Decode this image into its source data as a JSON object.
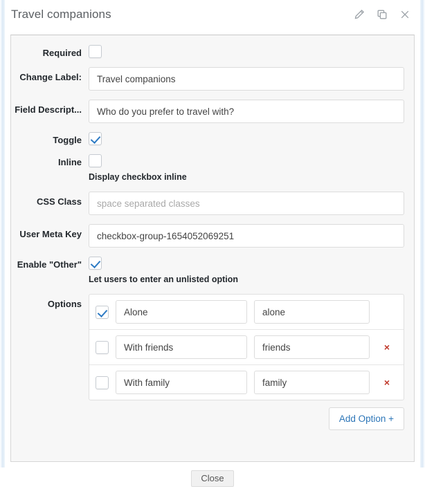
{
  "header": {
    "title": "Travel companions",
    "icons": [
      {
        "name": "edit-pencil-icon",
        "label": "Edit"
      },
      {
        "name": "duplicate-icon",
        "label": "Duplicate"
      },
      {
        "name": "close-icon",
        "label": "Close"
      }
    ]
  },
  "form": {
    "required": {
      "label": "Required",
      "checked": false
    },
    "change_label": {
      "label": "Change Label:",
      "value": "Travel companions",
      "placeholder": ""
    },
    "field_description": {
      "label": "Field Descript...",
      "value": "Who do you prefer to travel with?",
      "placeholder": ""
    },
    "toggle": {
      "label": "Toggle",
      "checked": true
    },
    "inline": {
      "label": "Inline",
      "checked": false,
      "helper": "Display checkbox inline"
    },
    "css_class": {
      "label": "CSS Class",
      "value": "",
      "placeholder": "space separated classes"
    },
    "user_meta_key": {
      "label": "User Meta Key",
      "value": "checkbox-group-1654052069251",
      "placeholder": ""
    },
    "enable_other": {
      "label": "Enable \"Other\"",
      "checked": true,
      "helper": "Let users to enter an unlisted option"
    },
    "options": {
      "label": "Options",
      "rows": [
        {
          "checked": true,
          "label": "Alone",
          "value": "alone",
          "deletable": false,
          "delete_glyph": "×"
        },
        {
          "checked": false,
          "label": "With friends",
          "value": "friends",
          "deletable": true,
          "delete_glyph": "×"
        },
        {
          "checked": false,
          "label": "With family",
          "value": "family",
          "deletable": true,
          "delete_glyph": "×"
        }
      ],
      "add_button": "Add Option +"
    }
  },
  "footer": {
    "close_label": "Close"
  },
  "colors": {
    "accent_blue": "#2d76b8",
    "check_blue": "#2e7bc4",
    "delete_red": "#c0392b",
    "panel_bg": "#f7f7f7",
    "border": "#dcdcdc",
    "title_text": "#5b5f63"
  }
}
